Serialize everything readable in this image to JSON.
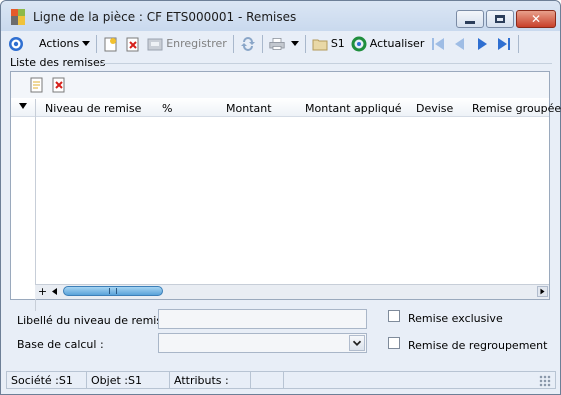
{
  "window": {
    "title": "Ligne de la pièce : CF ETS000001 -  Remises",
    "controls": {
      "minimize_icon": "minimize-icon",
      "maximize_icon": "maximize-icon",
      "close_icon": "close-icon"
    }
  },
  "toolbar": {
    "actions_label": "Actions",
    "save_label": "Enregistrer",
    "s1_label": "S1",
    "refresh_label": "Actualiser"
  },
  "section": {
    "title": "Liste des remises"
  },
  "grid": {
    "columns": [
      "Niveau de remise",
      "%",
      "Montant",
      "Montant appliqué",
      "Devise",
      "Remise groupée"
    ],
    "rows": [],
    "add_label": "+"
  },
  "form": {
    "libelle_label": "Libellé du niveau de remise :",
    "libelle_value": "",
    "base_label": "Base de calcul :",
    "base_value": "",
    "exclusive_label": "Remise exclusive",
    "exclusive_checked": false,
    "regroupement_label": "Remise de regroupement",
    "regroupement_checked": false
  },
  "status": {
    "societe": "Société :S1",
    "objet": "Objet :S1",
    "attributs": "Attributs :"
  },
  "colors": {
    "accent_blue": "#2f6fd1",
    "title_bg": "#c9d9ee",
    "close_red": "#c8402a"
  }
}
